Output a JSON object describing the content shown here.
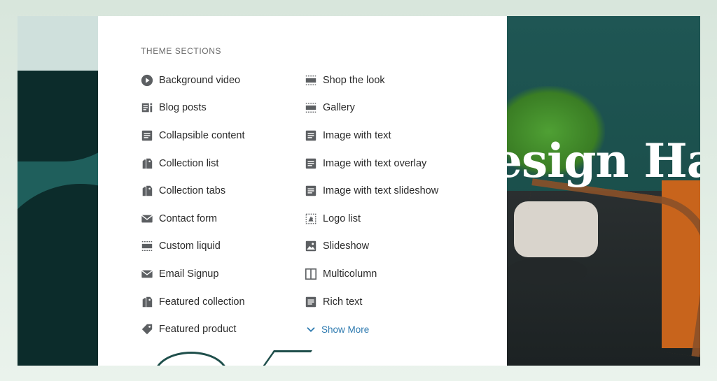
{
  "panel": {
    "heading": "THEME SECTIONS",
    "left_items": [
      {
        "label": "Background video",
        "icon": "play-circle-icon"
      },
      {
        "label": "Blog posts",
        "icon": "blog-icon"
      },
      {
        "label": "Collapsible content",
        "icon": "document-icon"
      },
      {
        "label": "Collection list",
        "icon": "collection-tag-icon"
      },
      {
        "label": "Collection tabs",
        "icon": "collection-tag-icon"
      },
      {
        "label": "Contact form",
        "icon": "envelope-icon"
      },
      {
        "label": "Custom liquid",
        "icon": "section-dashed-icon"
      },
      {
        "label": "Email Signup",
        "icon": "envelope-icon"
      },
      {
        "label": "Featured collection",
        "icon": "collection-tag-icon"
      },
      {
        "label": "Featured product",
        "icon": "product-tag-icon"
      }
    ],
    "right_items": [
      {
        "label": "Shop the look",
        "icon": "section-dashed-icon"
      },
      {
        "label": "Gallery",
        "icon": "section-dashed-icon"
      },
      {
        "label": "Image with text",
        "icon": "document-icon"
      },
      {
        "label": "Image with text overlay",
        "icon": "document-icon"
      },
      {
        "label": "Image with text slideshow",
        "icon": "document-icon"
      },
      {
        "label": "Logo list",
        "icon": "logo-dashed-icon"
      },
      {
        "label": "Slideshow",
        "icon": "image-icon"
      },
      {
        "label": "Multicolumn",
        "icon": "columns-icon"
      },
      {
        "label": "Rich text",
        "icon": "document-icon"
      }
    ],
    "show_more": "Show More"
  },
  "hero": {
    "title_fragment": "esign Ha"
  },
  "colors": {
    "icon": "#5c5f62",
    "link": "#2f7bb0",
    "dark_teal": "#0c2c2b",
    "teal": "#1f5f5c"
  }
}
